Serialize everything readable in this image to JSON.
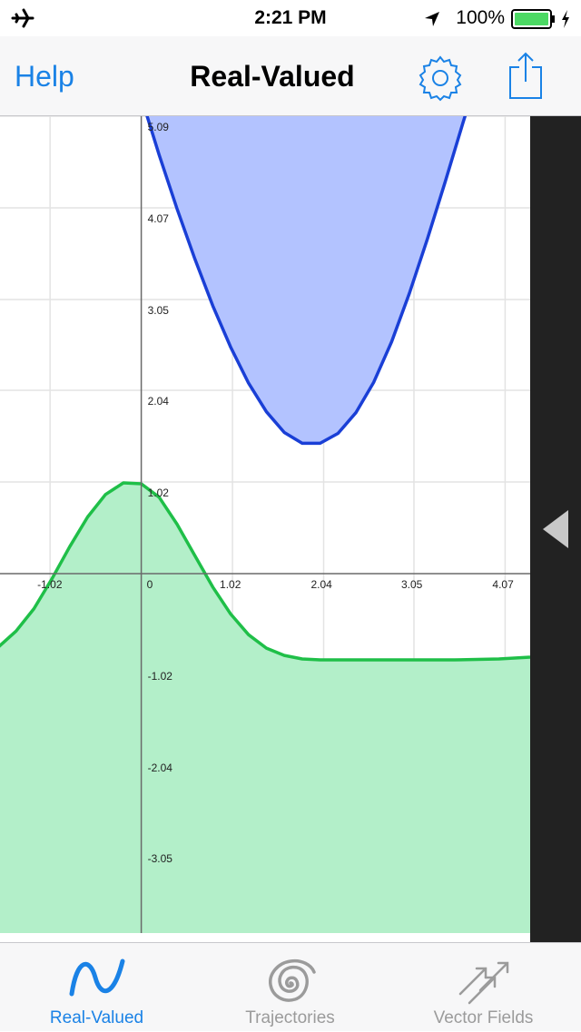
{
  "status_bar": {
    "time": "2:21 PM",
    "battery_percent": "100%",
    "icons": [
      "airplane-icon",
      "location-arrow-icon",
      "battery-icon",
      "charging-bolt-icon"
    ]
  },
  "nav": {
    "left_label": "Help",
    "title": "Real-Valued",
    "right_icons": [
      "gear-icon",
      "share-icon"
    ],
    "accent": "#1a82e6"
  },
  "chart_data": {
    "type": "area",
    "x_ticks": [
      "-1.02",
      "0",
      "1.02",
      "2.04",
      "3.05",
      "4.07"
    ],
    "y_ticks": [
      "5.09",
      "4.07",
      "3.05",
      "2.04",
      "1.02",
      "-1.02",
      "-2.04",
      "-3.05"
    ],
    "xlim": [
      -1.58,
      4.35
    ],
    "ylim": [
      -4.0,
      5.09
    ],
    "grid": true,
    "series": [
      {
        "color": "#1a3fd6",
        "fill": "#b3c3ff",
        "x": [
          0.0,
          0.2,
          0.4,
          0.6,
          0.8,
          1.0,
          1.2,
          1.4,
          1.6,
          1.8,
          2.0,
          2.2,
          2.4,
          2.6,
          2.8,
          3.0,
          3.2,
          3.4,
          3.6,
          3.8,
          3.9
        ],
        "y": [
          5.3,
          4.66,
          4.06,
          3.5,
          2.98,
          2.52,
          2.12,
          1.8,
          1.57,
          1.45,
          1.45,
          1.56,
          1.79,
          2.13,
          2.58,
          3.12,
          3.72,
          4.36,
          5.02,
          5.66,
          6.0
        ]
      },
      {
        "color": "#1fbf48",
        "fill": "#b3efc9",
        "x": [
          -1.6,
          -1.4,
          -1.2,
          -1.0,
          -0.8,
          -0.6,
          -0.4,
          -0.2,
          0.0,
          0.2,
          0.4,
          0.6,
          0.8,
          1.0,
          1.2,
          1.4,
          1.6,
          1.8,
          2.0,
          2.5,
          3.0,
          3.5,
          4.0,
          4.35
        ],
        "y": [
          -0.82,
          -0.64,
          -0.39,
          -0.06,
          0.3,
          0.63,
          0.88,
          1.01,
          1.0,
          0.85,
          0.55,
          0.2,
          -0.15,
          -0.45,
          -0.68,
          -0.83,
          -0.91,
          -0.95,
          -0.96,
          -0.96,
          -0.96,
          -0.96,
          -0.95,
          -0.93
        ]
      }
    ]
  },
  "tabs": [
    {
      "label": "Real-Valued",
      "icon": "wave-icon",
      "active": true
    },
    {
      "label": "Trajectories",
      "icon": "spiral-icon",
      "active": false
    },
    {
      "label": "Vector Fields",
      "icon": "arrows-icon",
      "active": false
    }
  ],
  "colors": {
    "active_tab": "#1a82e6",
    "inactive_tab": "#9b9b9b"
  }
}
